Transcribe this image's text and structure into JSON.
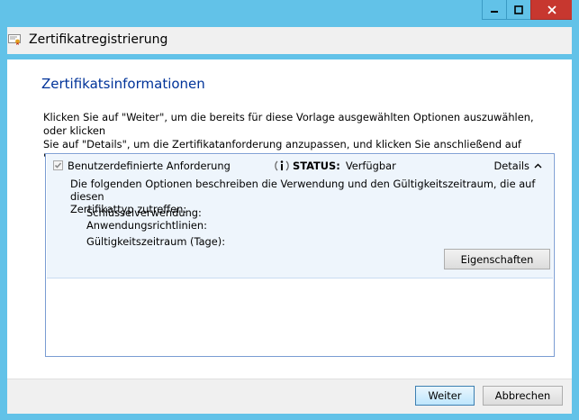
{
  "window": {
    "title": "Zertifikatregistrierung",
    "accent_color": "#62c2e8",
    "close_color": "#c7372f"
  },
  "page": {
    "heading": "Zertifikatsinformationen",
    "intro_line1": "Klicken Sie auf \"Weiter\", um die bereits für diese Vorlage ausgewählten Optionen auszuwählen, oder klicken",
    "intro_line2": "Sie auf \"Details\", um die Zertifikatanforderung anzupassen, und klicken Sie anschließend auf \"Weiter\"."
  },
  "cert_item": {
    "checkbox_label": "Benutzerdefinierte Anforderung",
    "checked": true,
    "status_key": "STATUS:",
    "status_value": "Verfügbar",
    "details_label": "Details",
    "description_line1": "Die folgenden Optionen beschreiben die Verwendung und den Gültigkeitszeitraum, die auf diesen",
    "description_line2": "Zertifikattyp zutreffen:",
    "fields": [
      "Schlüsselverwendung:",
      "Anwendungsrichtlinien:",
      "Gültigkeitszeitraum (Tage):"
    ],
    "properties_button": "Eigenschaften"
  },
  "footer": {
    "next_button": "Weiter",
    "cancel_button": "Abbrechen"
  },
  "icons": {
    "title": "certificate-icon",
    "status": "info-icon",
    "details": "chevron-up-icon",
    "minimize": "minimize-icon",
    "maximize": "maximize-icon",
    "close": "close-icon"
  }
}
